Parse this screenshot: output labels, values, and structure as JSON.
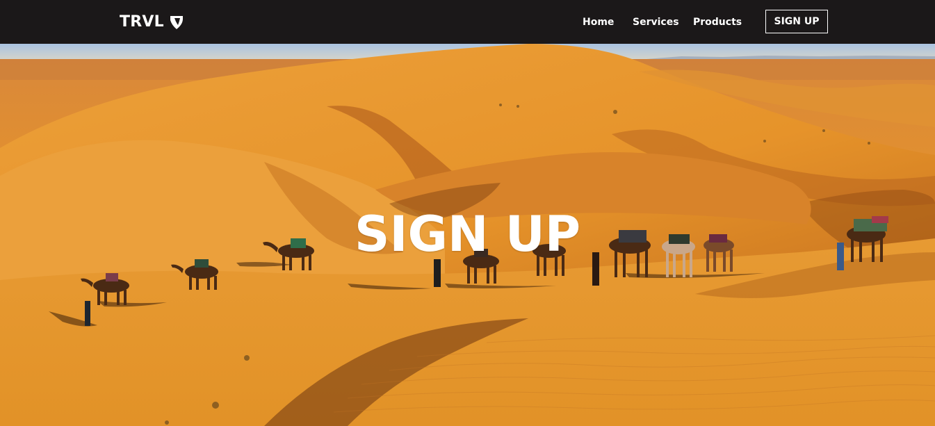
{
  "navbar": {
    "brand": "TRVL",
    "brand_logo_icon": "typo3-logo-icon",
    "links": [
      {
        "label": "Home"
      },
      {
        "label": "Services"
      },
      {
        "label": "Products"
      }
    ],
    "signup_label": "SIGN UP"
  },
  "hero": {
    "title": "SIGN UP",
    "background_image": "desert-dunes-camel-caravan-photo"
  },
  "colors": {
    "navbar_bg": "#1b1819",
    "text": "#ffffff",
    "sand": "#e8962e",
    "sky": "#b9cfe6"
  }
}
